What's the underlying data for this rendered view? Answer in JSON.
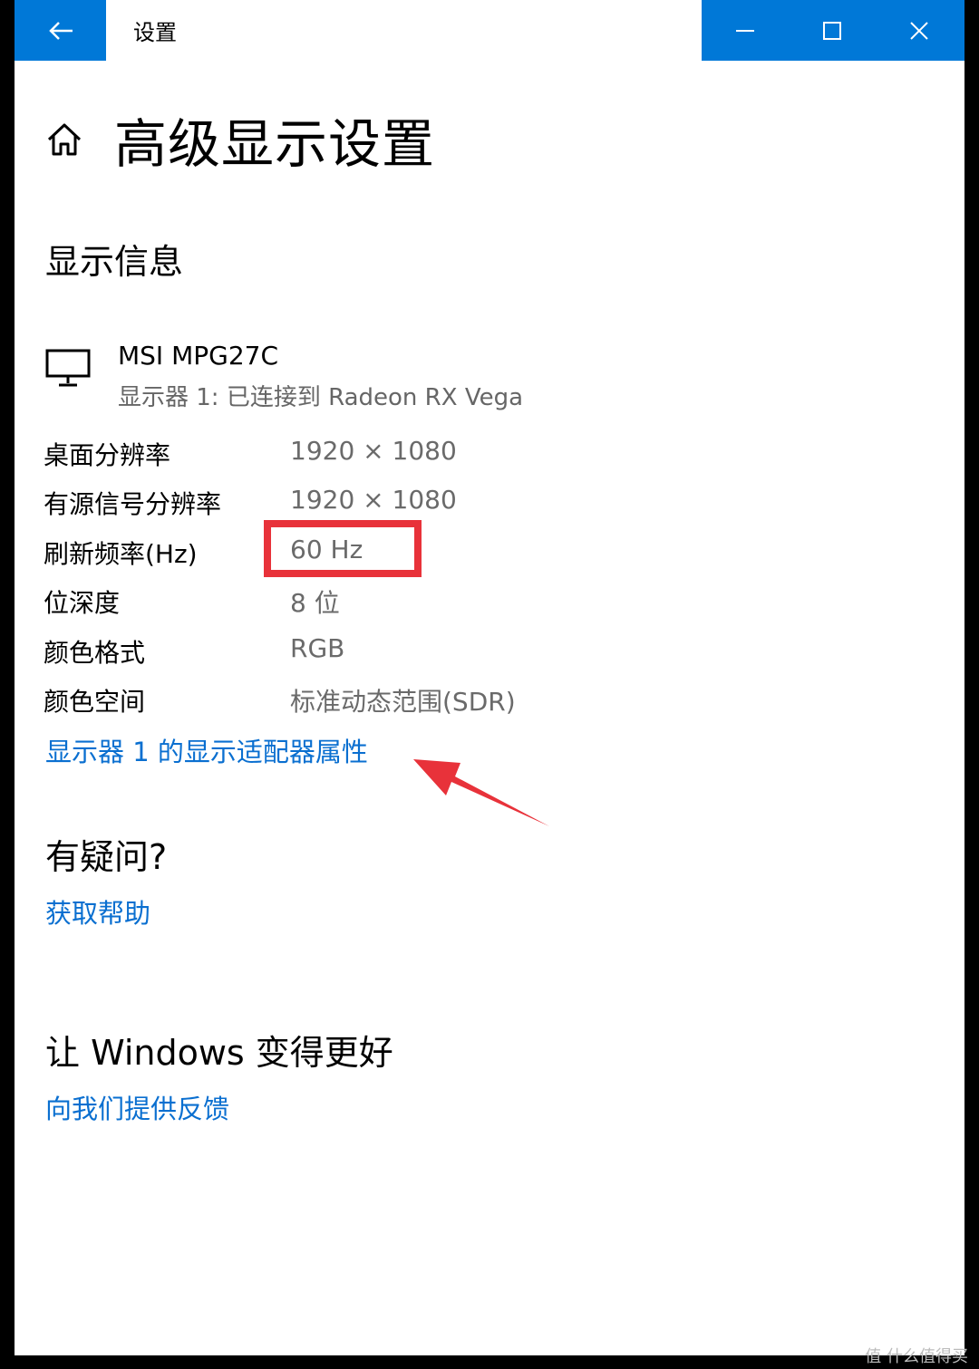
{
  "window": {
    "title": "设置"
  },
  "page": {
    "title": "高级显示设置"
  },
  "display_info": {
    "heading": "显示信息",
    "monitor_name": "MSI MPG27C",
    "monitor_sub": "显示器 1: 已连接到 Radeon RX Vega",
    "rows": [
      {
        "label": "桌面分辨率",
        "value": "1920 × 1080"
      },
      {
        "label": "有源信号分辨率",
        "value": "1920 × 1080"
      },
      {
        "label": "刷新频率(Hz)",
        "value": "60 Hz"
      },
      {
        "label": "位深度",
        "value": "8 位"
      },
      {
        "label": "颜色格式",
        "value": "RGB"
      },
      {
        "label": "颜色空间",
        "value": "标准动态范围(SDR)"
      }
    ],
    "adapter_link": "显示器 1 的显示适配器属性"
  },
  "help": {
    "heading": "有疑问?",
    "link": "获取帮助"
  },
  "feedback": {
    "heading": "让 Windows 变得更好",
    "link": "向我们提供反馈"
  },
  "watermark": "值 什么值得买",
  "colors": {
    "accent": "#0078d7",
    "link": "#0a6fd0",
    "annotation": "#e8323a"
  }
}
